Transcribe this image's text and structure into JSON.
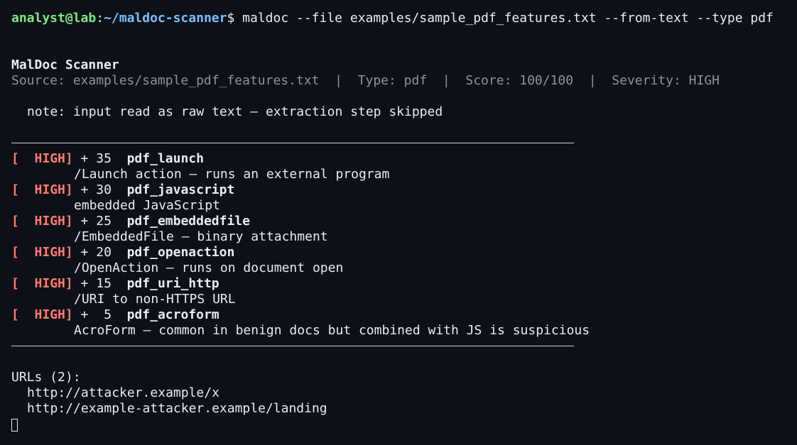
{
  "prompt": {
    "user_host": "analyst@lab",
    "separator": ":",
    "cwd": "~/maldoc-scanner",
    "symbol": "$",
    "command": " maldoc --file examples/sample_pdf_features.txt --from-text --type pdf"
  },
  "report": {
    "title": "MalDoc Scanner",
    "source_line": "Source: examples/sample_pdf_features.txt  |  Type: pdf  |  Score: 100/100  |  Severity: HIGH",
    "note": "note: input read as raw text — extraction step skipped"
  },
  "findings": [
    {
      "sev_open": "[",
      "severity": "  HIGH",
      "sev_close": "]",
      "score": " + 35",
      "name": "pdf_launch",
      "desc": "/Launch action — runs an external program"
    },
    {
      "sev_open": "[",
      "severity": "  HIGH",
      "sev_close": "]",
      "score": " + 30",
      "name": "pdf_javascript",
      "desc": "embedded JavaScript"
    },
    {
      "sev_open": "[",
      "severity": "  HIGH",
      "sev_close": "]",
      "score": " + 25",
      "name": "pdf_embeddedfile",
      "desc": "/EmbeddedFile — binary attachment"
    },
    {
      "sev_open": "[",
      "severity": "  HIGH",
      "sev_close": "]",
      "score": " + 20",
      "name": "pdf_openaction",
      "desc": "/OpenAction — runs on document open"
    },
    {
      "sev_open": "[",
      "severity": "  HIGH",
      "sev_close": "]",
      "score": " + 15",
      "name": "pdf_uri_http",
      "desc": "/URI to non-HTTPS URL"
    },
    {
      "sev_open": "[",
      "severity": "  HIGH",
      "sev_close": "]",
      "score": " +  5",
      "name": "pdf_acroform",
      "desc": "AcroForm — common in benign docs but combined with JS is suspicious"
    }
  ],
  "urls": {
    "header": "URLs (2):",
    "items": [
      "http://attacker.example/x",
      "http://example-attacker.example/landing"
    ]
  },
  "colors": {
    "background": "#0d1117",
    "prompt_user": "#7ee787",
    "prompt_path": "#79c0ff",
    "severity_high": "#ff7b72",
    "dim_text": "#8b949e"
  }
}
